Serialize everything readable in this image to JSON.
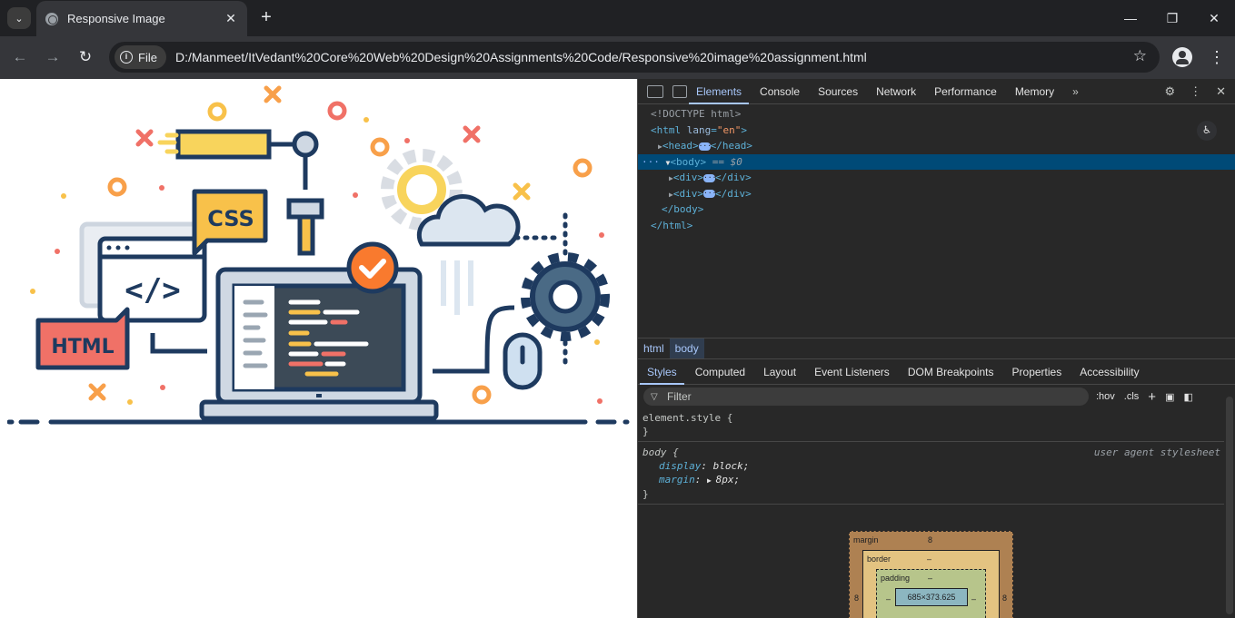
{
  "browser": {
    "tab_title": "Responsive Image",
    "url_chip": "File",
    "url": "D:/Manmeet/ItVedant%20Core%20Web%20Design%20Assignments%20Code/Responsive%20image%20assignment.html"
  },
  "page": {
    "css_label": "CSS",
    "html_label": "HTML",
    "code_label": "</>"
  },
  "devtools": {
    "tabs": [
      "Elements",
      "Console",
      "Sources",
      "Network",
      "Performance",
      "Memory"
    ],
    "more": "»",
    "dom": {
      "doctype": "<!DOCTYPE html>",
      "html_open_tag": "<html",
      "html_attr": "lang",
      "html_attr_val": "\"en\"",
      "head": "head",
      "body": "body",
      "body_marker": "== $0",
      "div": "div",
      "html": "html"
    },
    "breadcrumbs": [
      "html",
      "body"
    ],
    "sub_tabs": [
      "Styles",
      "Computed",
      "Layout",
      "Event Listeners",
      "DOM Breakpoints",
      "Properties",
      "Accessibility"
    ],
    "filter_placeholder": "Filter",
    "filter_hov": ":hov",
    "filter_cls": ".cls",
    "rules": {
      "element_style": "element.style {",
      "close": "}",
      "body_selector": "body {",
      "origin": "user agent stylesheet",
      "prop1": "display",
      "val1": "block;",
      "prop2": "margin",
      "val2": "8px;"
    },
    "box_model": {
      "margin_label": "margin",
      "margin_value": "8",
      "border_label": "border",
      "border_value": "–",
      "padding_label": "padding",
      "padding_value": "–",
      "content": "685×373.625",
      "side_value": "8"
    }
  },
  "colors": {
    "accent": "#a8c7fa",
    "selection": "#004a77",
    "navy": "#1e3a5f",
    "orange": "#f97a2e",
    "yellow": "#f8c14a",
    "red": "#f07167"
  }
}
